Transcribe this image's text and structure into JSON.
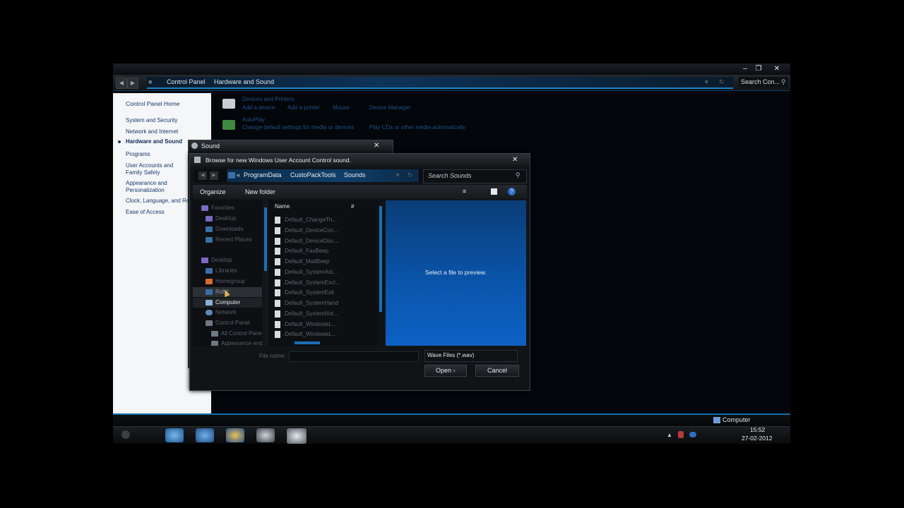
{
  "cp_window": {
    "breadcrumb": [
      "Control Panel",
      "Hardware and Sound"
    ],
    "search_placeholder": "Search Con...",
    "sidebar": {
      "home": "Control Panel Home",
      "items": [
        "System and Security",
        "Network and Internet",
        "Hardware and Sound",
        "Programs",
        "User Accounts and Family Safety",
        "Appearance and Personalization",
        "Clock, Language, and Region",
        "Ease of Access"
      ],
      "active_index": 2
    },
    "main": {
      "devices_title": "Devices and Printers",
      "devices_links": [
        "Add a device",
        "Add a printer",
        "Mouse",
        "Device Manager"
      ],
      "autoplay_title": "AutoPlay",
      "autoplay_links": [
        "Change default settings for media or devices",
        "Play CDs or other media automatically"
      ]
    },
    "status_computer": "Computer"
  },
  "sound_dialog": {
    "title": "Sound"
  },
  "browse_dialog": {
    "title": "Browse for new Windows User Account Control sound.",
    "path": [
      "ProgramData",
      "CustoPackTools",
      "Sounds"
    ],
    "search_placeholder": "Search Sounds",
    "toolbar": {
      "organize": "Organize",
      "new_folder": "New folder"
    },
    "nav": {
      "favorites": "Favorites",
      "favorites_items": [
        "Desktop",
        "Downloads",
        "Recent Places"
      ],
      "desktop": "Desktop",
      "desktop_items": [
        "Libraries",
        "Homegroup",
        "Rohit",
        "Computer",
        "Network",
        "Control Panel",
        "All Control Panel Items",
        "Appearance and Personalization"
      ]
    },
    "columns": {
      "name": "Name",
      "num": "#"
    },
    "files": [
      ".Default_ChangeTh...",
      ".Default_DeviceCon...",
      ".Default_DeviceDisc...",
      ".Default_FaxBeep",
      ".Default_MailBeep",
      ".Default_SystemAst...",
      ".Default_SystemExcl...",
      ".Default_SystemExit",
      ".Default_SystemHand",
      ".Default_SystemNot...",
      ".Default_WindowsL...",
      ".Default_WindowsL..."
    ],
    "preview_text": "Select a file to preview.",
    "file_name_label": "File name:",
    "file_name_value": "",
    "file_type": "Wave Files (*.wav)",
    "open_label": "Open",
    "cancel_label": "Cancel"
  },
  "taskbar": {
    "time": "15:52",
    "date": "27-02-2012"
  },
  "colors": {
    "accent": "#1b82c8",
    "preview_blue": "#0a56ad"
  },
  "icons": [
    "back-icon",
    "forward-icon",
    "search-icon",
    "printer-icon",
    "autoplay-icon",
    "folder-icon",
    "sound-file-icon",
    "help-icon",
    "view-icon",
    "close-icon"
  ]
}
